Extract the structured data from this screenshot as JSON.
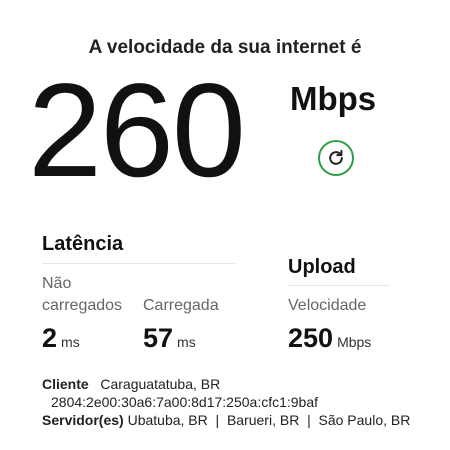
{
  "headline": "A velocidade da sua internet é",
  "speed": {
    "value": "260",
    "unit": "Mbps"
  },
  "refresh_icon": "refresh-icon",
  "accent_color": "#2e9e4a",
  "latency": {
    "title": "Latência",
    "unloaded_label": "Não carregados",
    "unloaded_value": "2",
    "unloaded_unit": "ms",
    "loaded_label": "Carregada",
    "loaded_value": "57",
    "loaded_unit": "ms"
  },
  "upload": {
    "title": "Upload",
    "label": "Velocidade",
    "value": "250",
    "unit": "Mbps"
  },
  "client": {
    "label": "Cliente",
    "location": "Caraguatatuba, BR",
    "ip": "2804:2e00:30a6:7a00:8d17:250a:cfc1:9baf"
  },
  "servers": {
    "label": "Servidor(es)",
    "list": "Ubatuba, BR  |  Barueri, BR  |  São Paulo, BR"
  }
}
